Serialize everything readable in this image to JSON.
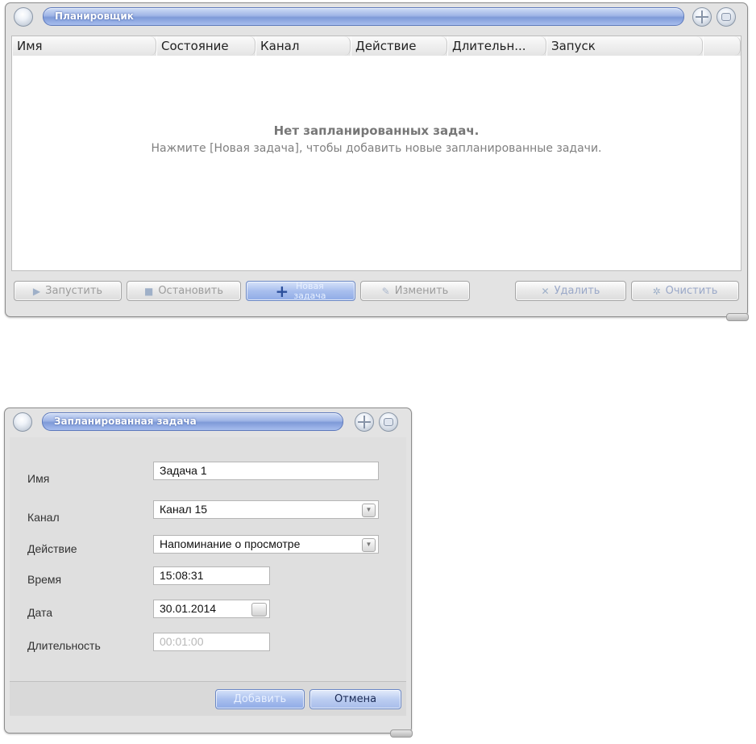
{
  "scheduler": {
    "title": "Планировщик",
    "columns": [
      "Имя",
      "Состояние",
      "Канал",
      "Действие",
      "Длительн...",
      "Запуск"
    ],
    "empty_title": "Нет запланированных задач.",
    "empty_hint": "Нажмите [Новая задача], чтобы добавить новые запланированные задачи.",
    "buttons": {
      "start": "Запустить",
      "stop": "Остановить",
      "new_task_line1": "Новая",
      "new_task_line2": "задача",
      "edit": "Изменить",
      "delete": "Удалить",
      "clear": "Очистить"
    }
  },
  "task_dialog": {
    "title": "Запланированная задача",
    "labels": {
      "name": "Имя",
      "channel": "Канал",
      "action": "Действие",
      "time": "Время",
      "date": "Дата",
      "duration": "Длительность"
    },
    "values": {
      "name": "Задача 1",
      "channel": "Канал 15",
      "action": "Напоминание о просмотре",
      "time": "15:08:31",
      "date": "30.01.2014",
      "duration": "00:01:00"
    },
    "buttons": {
      "add": "Добавить",
      "cancel": "Отмена"
    }
  }
}
